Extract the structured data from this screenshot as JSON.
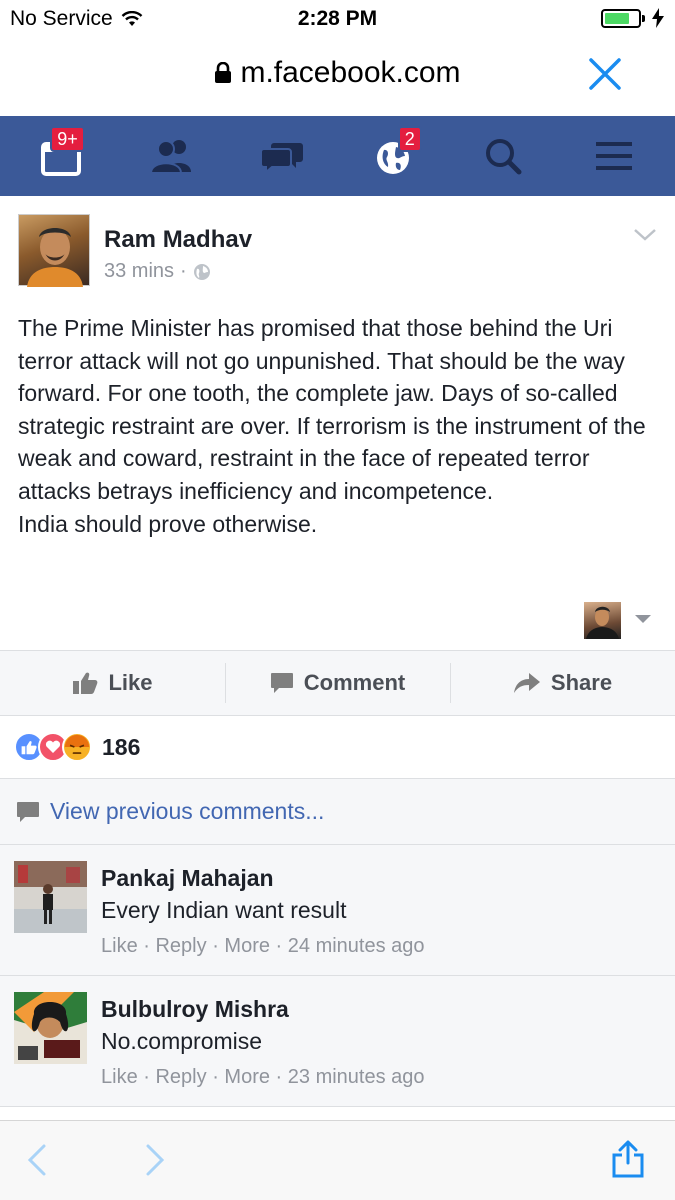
{
  "status_bar": {
    "carrier": "No Service",
    "time": "2:28 PM"
  },
  "browser": {
    "url": "m.facebook.com"
  },
  "fb_nav": {
    "notifications_badge": "9+",
    "globe_badge": "2"
  },
  "post": {
    "author": "Ram Madhav",
    "time": "33 mins",
    "separator": "·",
    "paragraph1": "The Prime Minister has promised that those behind the Uri terror attack will not go unpunished. That should be the way forward. For one tooth, the complete jaw. Days of so-called strategic restraint are over. If terrorism is the instrument of the weak and coward, restraint in the face of repeated terror attacks betrays inefficiency and incompetence.",
    "paragraph2": "India should prove otherwise."
  },
  "actions": {
    "like": "Like",
    "comment": "Comment",
    "share": "Share"
  },
  "reactions": {
    "count": "186",
    "types": [
      "like",
      "love",
      "angry"
    ]
  },
  "comments_section": {
    "view_previous": "View previous comments...",
    "items": [
      {
        "name": "Pankaj Mahajan",
        "text": "Every Indian want result",
        "like": "Like",
        "reply": "Reply",
        "more": "More",
        "time": "24 minutes ago"
      },
      {
        "name": "Bulbulroy Mishra",
        "text": "No.compromise",
        "like": "Like",
        "reply": "Reply",
        "more": "More",
        "time": "23 minutes ago"
      }
    ]
  },
  "colors": {
    "fb_blue": "#3b5998",
    "link_blue": "#4267b2",
    "ios_blue": "#1a8cf0",
    "badge_red": "#e41e3f",
    "battery_green": "#4cd964"
  }
}
